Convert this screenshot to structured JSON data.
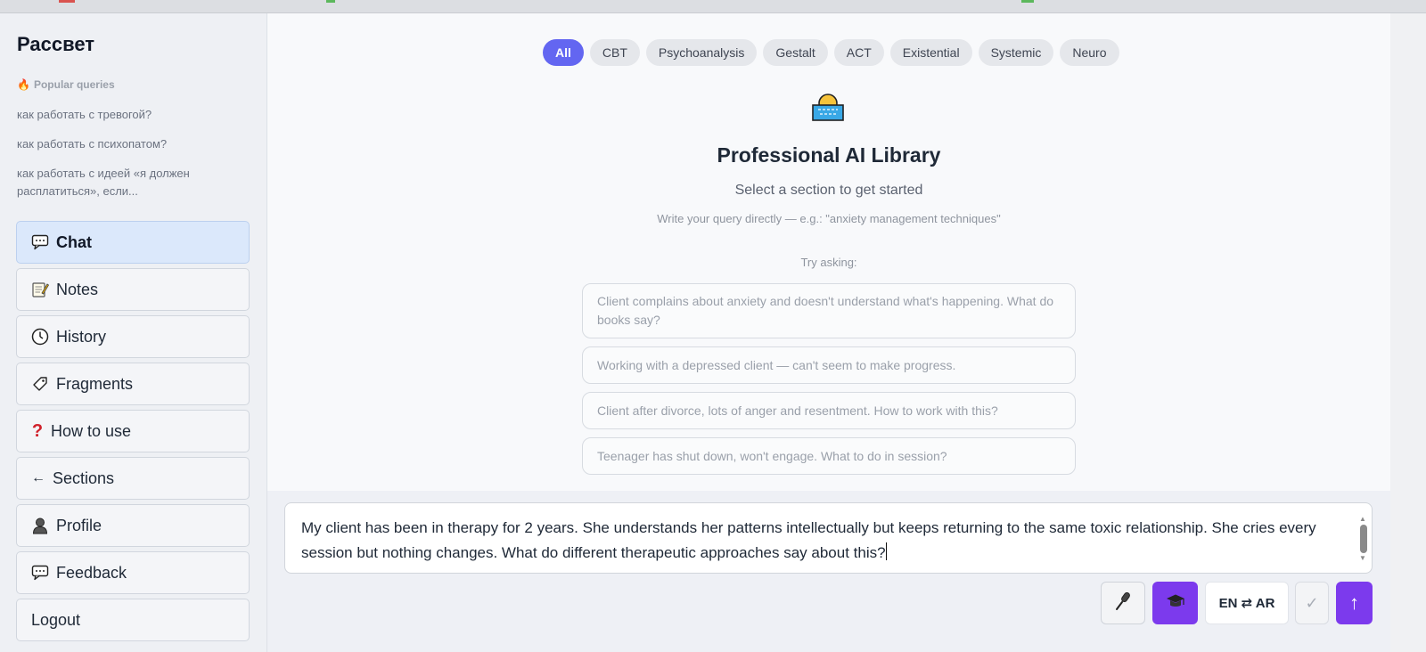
{
  "app": {
    "brand": "Рассвет"
  },
  "sidebar": {
    "popular_title": "Popular queries",
    "popular_queries": [
      "как работать с тревогой?",
      "как работать с психопатом?",
      "как работать с идеей «я должен расплатиться», если..."
    ],
    "nav": [
      {
        "label": "Chat",
        "icon": "speech-bubble-icon",
        "active": true
      },
      {
        "label": "Notes",
        "icon": "memo-icon"
      },
      {
        "label": "History",
        "icon": "clock-icon"
      },
      {
        "label": "Fragments",
        "icon": "tag-icon"
      },
      {
        "label": "How to use",
        "icon": "question-mark-icon"
      },
      {
        "label": "Sections",
        "icon": "left-arrow-icon"
      },
      {
        "label": "Profile",
        "icon": "person-icon"
      },
      {
        "label": "Feedback",
        "icon": "speech-bubble-icon"
      },
      {
        "label": "Logout",
        "icon": ""
      }
    ]
  },
  "filters": {
    "tabs": [
      "All",
      "CBT",
      "Psychoanalysis",
      "Gestalt",
      "ACT",
      "Existential",
      "Systemic",
      "Neuro"
    ],
    "active": "All"
  },
  "hero": {
    "icon": "sunrise-icon",
    "title": "Professional AI Library",
    "subtitle": "Select a section to get started",
    "hint": "Write your query directly — e.g.: \"anxiety management techniques\"",
    "try_label": "Try asking:"
  },
  "suggestions": [
    "Client complains about anxiety and doesn't understand what's happening. What do books say?",
    "Working with a depressed client — can't seem to make progress.",
    "Client after divorce, lots of anger and resentment. How to work with this?",
    "Teenager has shut down, won't engage. What to do in session?"
  ],
  "composer": {
    "value": "My client has been in therapy for 2 years. She understands her patterns intellectually but keeps returning to the same toxic relationship. She cries every session but nothing changes. What do different therapeutic approaches say about this?",
    "lang_toggle": "EN ⇄ AR",
    "check_glyph": "✓",
    "send_glyph": "↑"
  },
  "colors": {
    "accent": "#6366f1",
    "purple": "#7c3aed"
  }
}
